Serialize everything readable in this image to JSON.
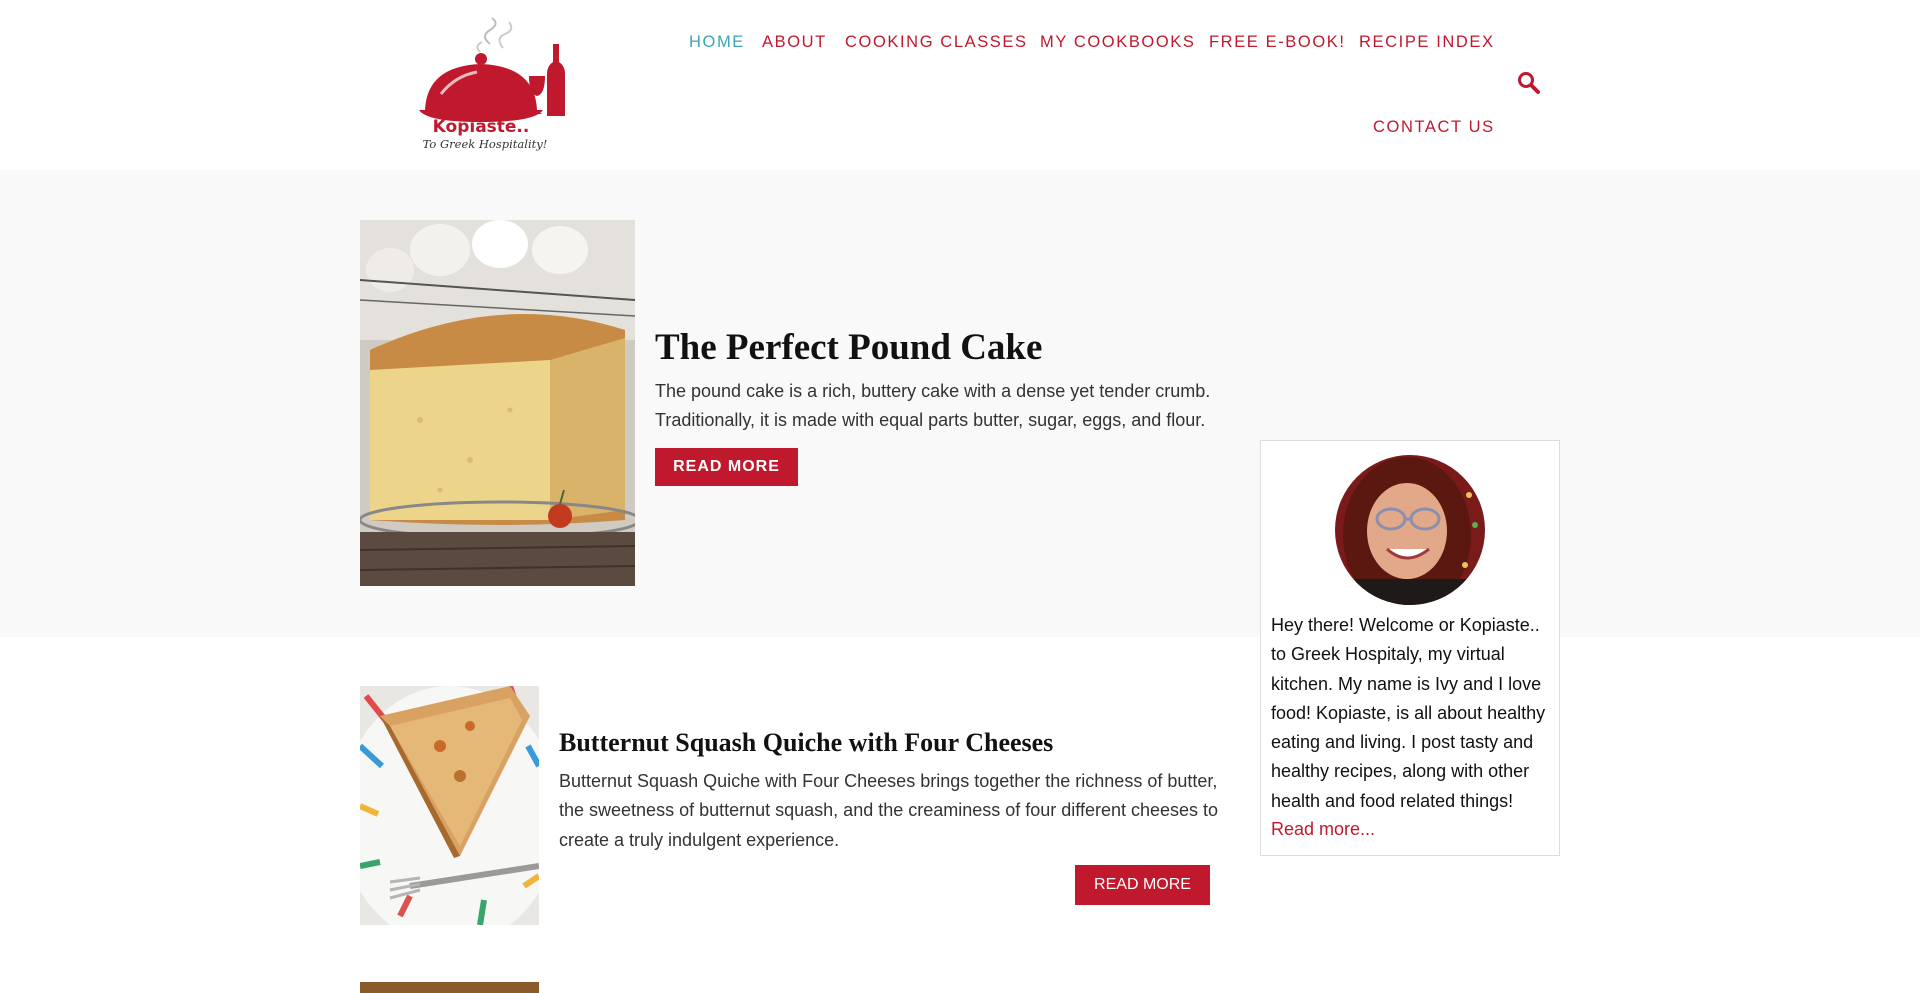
{
  "header": {
    "logo": {
      "brand_text": "Kopiaste..",
      "tagline": "To Greek Hospitality!"
    },
    "nav": [
      {
        "label": "HOME",
        "active": true
      },
      {
        "label": "ABOUT",
        "active": false
      },
      {
        "label": "COOKING CLASSES",
        "active": false
      },
      {
        "label": "MY COOKBOOKS",
        "active": false
      },
      {
        "label": "FREE E-BOOK!",
        "active": false
      },
      {
        "label": "RECIPE INDEX",
        "active": false
      },
      {
        "label": "CONTACT US",
        "active": false
      }
    ],
    "search_icon": "search-icon"
  },
  "featured_post": {
    "title": "The Perfect Pound Cake",
    "excerpt": "The pound cake is a rich, buttery cake with a dense yet tender crumb. Traditionally, it is made with equal parts butter, sugar, eggs, and flour.",
    "button_label": "READ MORE"
  },
  "sidebar": {
    "about_text": "Hey there! Welcome or Kopiaste.. to Greek Hospitaly, my virtual kitchen. My name is Ivy and I love food! Kopiaste, is all about healthy eating and living. I post tasty and healthy recipes, along with other health and food related things!",
    "read_more_label": "Read more..."
  },
  "posts": [
    {
      "title": "Butternut Squash Quiche with Four Cheeses",
      "excerpt": "Butternut Squash Quiche with Four Cheeses brings together the richness of butter, the sweetness of butternut squash, and the creaminess of four different cheeses to create a truly indulgent experience.",
      "button_label": "READ MORE"
    }
  ],
  "colors": {
    "brand_red": "#c0182d",
    "nav_active": "#3aa5b4",
    "band_background": "#f9f9f9"
  }
}
